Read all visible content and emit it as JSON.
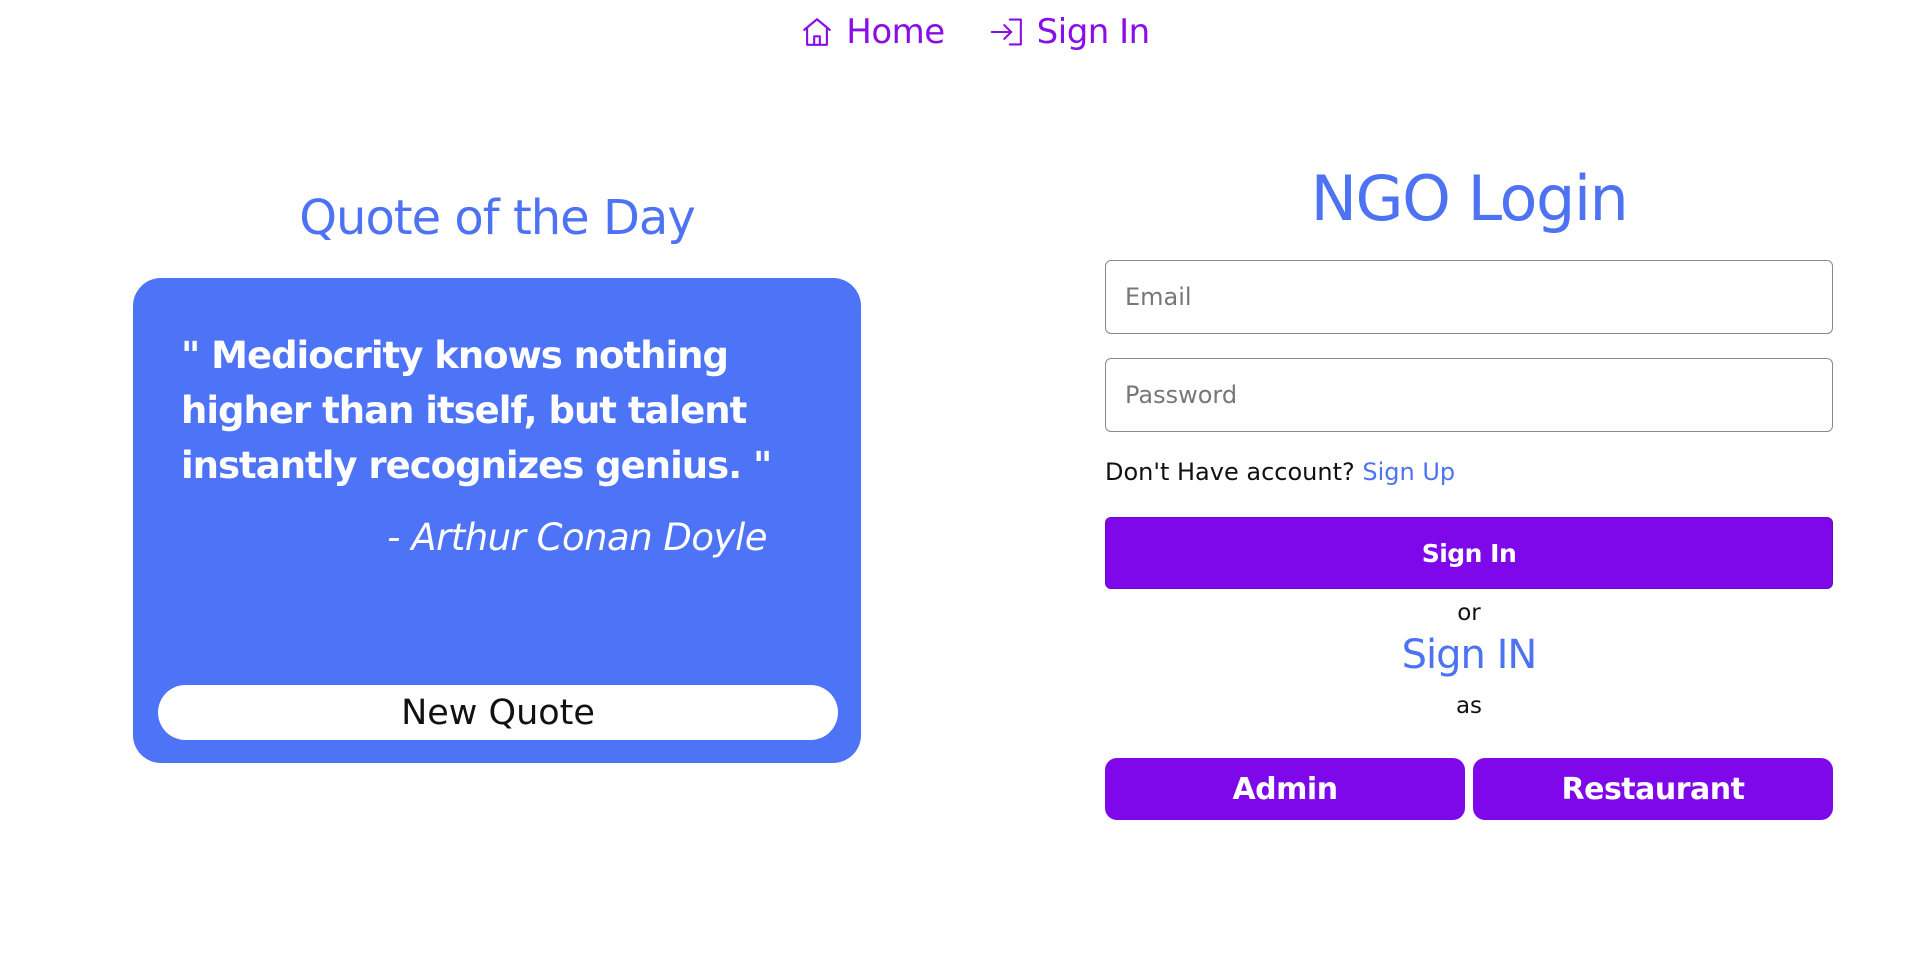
{
  "nav": {
    "home_label": "Home",
    "home_icon": "home-icon",
    "signin_label": "Sign In",
    "signin_icon": "sign-in-icon",
    "accent_color": "#8a0ee6"
  },
  "quote": {
    "title": "Quote of the Day",
    "text": "\" Mediocrity knows nothing higher than itself, but talent instantly recognizes genius. \"",
    "author": "- Arthur Conan Doyle",
    "button_label": "New Quote",
    "card_color": "#4d73f7"
  },
  "login": {
    "title": "NGO Login",
    "email_placeholder": "Email",
    "password_placeholder": "Password",
    "account_prompt": "Don't Have account?",
    "signup_link": "Sign Up",
    "signin_button": "Sign In",
    "or_text": "or",
    "signin_as_title": "Sign IN",
    "as_text": "as",
    "roles": [
      "Admin",
      "Restaurant"
    ],
    "button_color": "#7e08ea",
    "title_color": "#4d73f2"
  }
}
